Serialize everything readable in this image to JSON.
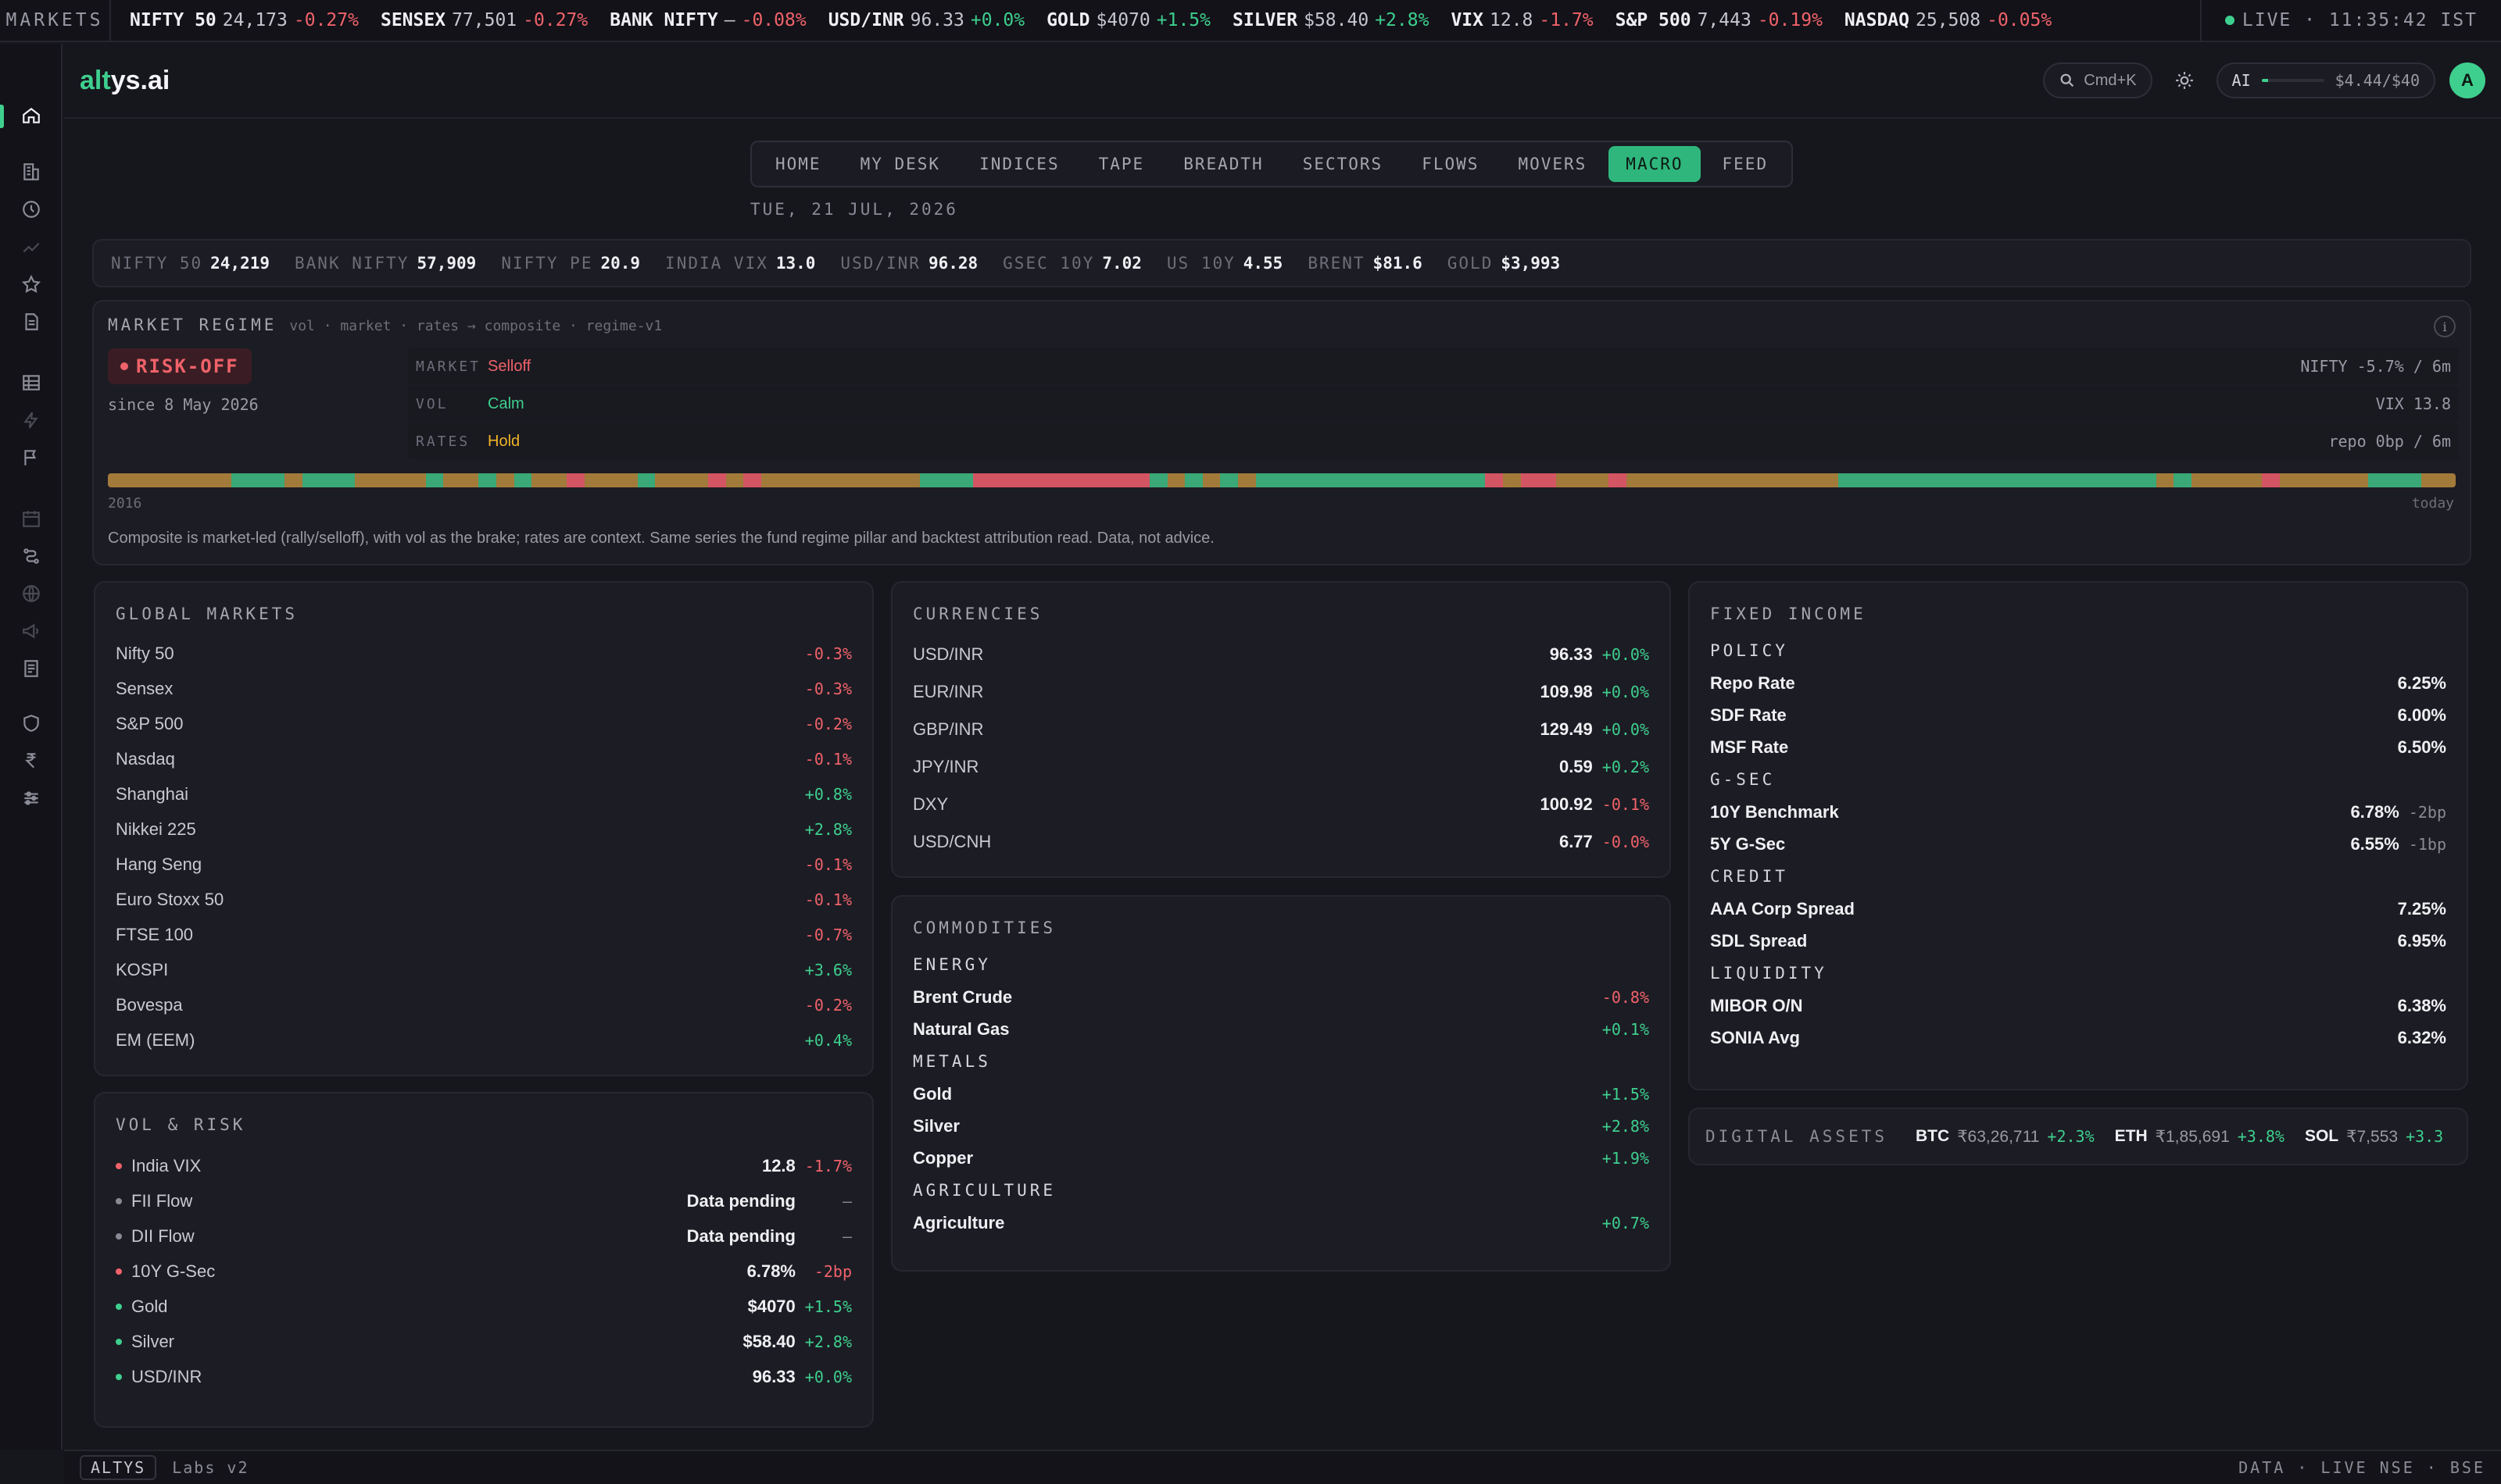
{
  "ticker": {
    "brand": "MARKETS",
    "items": [
      {
        "sym": "NIFTY 50",
        "val": "24,173",
        "chg": "-0.27%",
        "dir": "neg"
      },
      {
        "sym": "SENSEX",
        "val": "77,501",
        "chg": "-0.27%",
        "dir": "neg"
      },
      {
        "sym": "BANK NIFTY",
        "val": "—",
        "chg": "-0.08%",
        "dir": "neg"
      },
      {
        "sym": "USD/INR",
        "val": "96.33",
        "chg": "+0.0%",
        "dir": "pos"
      },
      {
        "sym": "GOLD",
        "val": "$4070",
        "chg": "+1.5%",
        "dir": "pos"
      },
      {
        "sym": "SILVER",
        "val": "$58.40",
        "chg": "+2.8%",
        "dir": "pos"
      },
      {
        "sym": "VIX",
        "val": "12.8",
        "chg": "-1.7%",
        "dir": "neg"
      },
      {
        "sym": "S&P 500",
        "val": "7,443",
        "chg": "-0.19%",
        "dir": "neg"
      },
      {
        "sym": "NASDAQ",
        "val": "25,508",
        "chg": "-0.05%",
        "dir": "neg"
      }
    ],
    "live": "LIVE · 11:35:42 IST"
  },
  "header": {
    "logo_a": "alt",
    "logo_b": "ys.ai",
    "search_hint": "Cmd+K",
    "ai_label": "AI",
    "ai_cost": "$4.44/$40",
    "ai_usage_fraction": 0.11,
    "avatar": "A"
  },
  "tabs": [
    "HOME",
    "MY DESK",
    "INDICES",
    "TAPE",
    "BREADTH",
    "SECTORS",
    "FLOWS",
    "MOVERS",
    "MACRO",
    "FEED"
  ],
  "active_tab": "MACRO",
  "date": "TUE, 21 JUL, 2026",
  "snapshot": [
    {
      "label": "NIFTY 50",
      "val": "24,219"
    },
    {
      "label": "BANK NIFTY",
      "val": "57,909"
    },
    {
      "label": "NIFTY PE",
      "val": "20.9"
    },
    {
      "label": "INDIA VIX",
      "val": "13.0"
    },
    {
      "label": "USD/INR",
      "val": "96.28"
    },
    {
      "label": "GSEC 10Y",
      "val": "7.02"
    },
    {
      "label": "US 10Y",
      "val": "4.55"
    },
    {
      "label": "BRENT",
      "val": "$81.6"
    },
    {
      "label": "GOLD",
      "val": "$3,993"
    }
  ],
  "regime": {
    "title": "MARKET REGIME",
    "subtitle": "vol · market · rates → composite · regime-v1",
    "badge": "RISK-OFF",
    "since": "since 8 May 2026",
    "rows": [
      {
        "label": "MARKET",
        "state": "Selloff",
        "tone": "neg",
        "right": "NIFTY -5.7% / 6m"
      },
      {
        "label": "VOL",
        "state": "Calm",
        "tone": "pos",
        "right": "VIX 13.8"
      },
      {
        "label": "RATES",
        "state": "Hold",
        "tone": "hold",
        "right": "repo 0bp / 6m"
      }
    ],
    "timeline_start": "2016",
    "timeline_end": "today",
    "note": "Composite is market-led (rally/selloff), with vol as the brake; rates are context. Same series the fund regime pillar and backtest attribution read. Data, not advice."
  },
  "global_markets": {
    "title": "GLOBAL MARKETS",
    "rows": [
      {
        "name": "Nifty 50",
        "chg": "-0.3%",
        "dir": "neg"
      },
      {
        "name": "Sensex",
        "chg": "-0.3%",
        "dir": "neg"
      },
      {
        "name": "S&P 500",
        "chg": "-0.2%",
        "dir": "neg"
      },
      {
        "name": "Nasdaq",
        "chg": "-0.1%",
        "dir": "neg"
      },
      {
        "name": "Shanghai",
        "chg": "+0.8%",
        "dir": "pos"
      },
      {
        "name": "Nikkei 225",
        "chg": "+2.8%",
        "dir": "pos"
      },
      {
        "name": "Hang Seng",
        "chg": "-0.1%",
        "dir": "neg"
      },
      {
        "name": "Euro Stoxx 50",
        "chg": "-0.1%",
        "dir": "neg"
      },
      {
        "name": "FTSE 100",
        "chg": "-0.7%",
        "dir": "neg"
      },
      {
        "name": "KOSPI",
        "chg": "+3.6%",
        "dir": "pos"
      },
      {
        "name": "Bovespa",
        "chg": "-0.2%",
        "dir": "neg"
      },
      {
        "name": "EM (EEM)",
        "chg": "+0.4%",
        "dir": "pos"
      }
    ]
  },
  "currencies": {
    "title": "CURRENCIES",
    "rows": [
      {
        "name": "USD/INR",
        "val": "96.33",
        "chg": "+0.0%",
        "dir": "pos"
      },
      {
        "name": "EUR/INR",
        "val": "109.98",
        "chg": "+0.0%",
        "dir": "pos"
      },
      {
        "name": "GBP/INR",
        "val": "129.49",
        "chg": "+0.0%",
        "dir": "pos"
      },
      {
        "name": "JPY/INR",
        "val": "0.59",
        "chg": "+0.2%",
        "dir": "pos"
      },
      {
        "name": "DXY",
        "val": "100.92",
        "chg": "-0.1%",
        "dir": "neg"
      },
      {
        "name": "USD/CNH",
        "val": "6.77",
        "chg": "-0.0%",
        "dir": "neg"
      }
    ]
  },
  "commodities": {
    "title": "COMMODITIES",
    "groups": [
      {
        "name": "ENERGY",
        "rows": [
          {
            "name": "Brent Crude",
            "chg": "-0.8%",
            "dir": "neg"
          },
          {
            "name": "Natural Gas",
            "chg": "+0.1%",
            "dir": "pos"
          }
        ]
      },
      {
        "name": "METALS",
        "rows": [
          {
            "name": "Gold",
            "chg": "+1.5%",
            "dir": "pos"
          },
          {
            "name": "Silver",
            "chg": "+2.8%",
            "dir": "pos"
          },
          {
            "name": "Copper",
            "chg": "+1.9%",
            "dir": "pos"
          }
        ]
      },
      {
        "name": "AGRICULTURE",
        "rows": [
          {
            "name": "Agriculture",
            "chg": "+0.7%",
            "dir": "pos"
          }
        ]
      }
    ]
  },
  "fixed_income": {
    "title": "FIXED INCOME",
    "groups": [
      {
        "name": "POLICY",
        "rows": [
          {
            "name": "Repo Rate",
            "val": "6.25%",
            "chg": ""
          },
          {
            "name": "SDF Rate",
            "val": "6.00%",
            "chg": ""
          },
          {
            "name": "MSF Rate",
            "val": "6.50%",
            "chg": ""
          }
        ]
      },
      {
        "name": "G-SEC",
        "rows": [
          {
            "name": "10Y Benchmark",
            "val": "6.78%",
            "chg": "-2bp"
          },
          {
            "name": "5Y G-Sec",
            "val": "6.55%",
            "chg": "-1bp"
          }
        ]
      },
      {
        "name": "CREDIT",
        "rows": [
          {
            "name": "AAA Corp Spread",
            "val": "7.25%",
            "chg": ""
          },
          {
            "name": "SDL Spread",
            "val": "6.95%",
            "chg": ""
          }
        ]
      },
      {
        "name": "LIQUIDITY",
        "rows": [
          {
            "name": "MIBOR O/N",
            "val": "6.38%",
            "chg": ""
          },
          {
            "name": "SONIA Avg",
            "val": "6.32%",
            "chg": ""
          }
        ]
      }
    ]
  },
  "vol_risk": {
    "title": "VOL & RISK",
    "rows": [
      {
        "name": "India VIX",
        "val": "12.8",
        "chg": "-1.7%",
        "dir": "neg",
        "dot": "#f0626a"
      },
      {
        "name": "FII Flow",
        "val": "Data pending",
        "chg": "—",
        "dir": "neu",
        "dot": "#8a8a96"
      },
      {
        "name": "DII Flow",
        "val": "Data pending",
        "chg": "—",
        "dir": "neu",
        "dot": "#8a8a96"
      },
      {
        "name": "10Y G-Sec",
        "val": "6.78%",
        "chg": "-2bp",
        "dir": "neg",
        "dot": "#f0626a"
      },
      {
        "name": "Gold",
        "val": "$4070",
        "chg": "+1.5%",
        "dir": "pos",
        "dot": "#3ecf8e"
      },
      {
        "name": "Silver",
        "val": "$58.40",
        "chg": "+2.8%",
        "dir": "pos",
        "dot": "#3ecf8e"
      },
      {
        "name": "USD/INR",
        "val": "96.33",
        "chg": "+0.0%",
        "dir": "pos",
        "dot": "#3ecf8e"
      }
    ]
  },
  "digital_assets": {
    "title": "DIGITAL ASSETS",
    "items": [
      {
        "sym": "BTC",
        "val": "₹63,26,711",
        "chg": "+2.3%",
        "dir": "pos"
      },
      {
        "sym": "ETH",
        "val": "₹1,85,691",
        "chg": "+3.8%",
        "dir": "pos"
      },
      {
        "sym": "SOL",
        "val": "₹7,553",
        "chg": "+3.3",
        "dir": "pos"
      }
    ]
  },
  "footer": {
    "badge": "ALTYS",
    "labs": "Labs v2",
    "right": "DATA · LIVE  NSE · BSE"
  },
  "colors": {
    "positive": "#3ecf8e",
    "negative": "#f0626a",
    "hold": "#f0b429",
    "accent": "#2fb67c",
    "background": "#16161d"
  },
  "icons": [
    "home-icon",
    "building-icon",
    "clock-icon",
    "trend-icon",
    "star-icon",
    "document-icon",
    "table-icon",
    "bolt-icon",
    "flag-icon",
    "calendar-icon",
    "route-icon",
    "globe-icon",
    "megaphone-icon",
    "report-icon",
    "shield-icon",
    "rupee-icon",
    "sliders-icon"
  ]
}
